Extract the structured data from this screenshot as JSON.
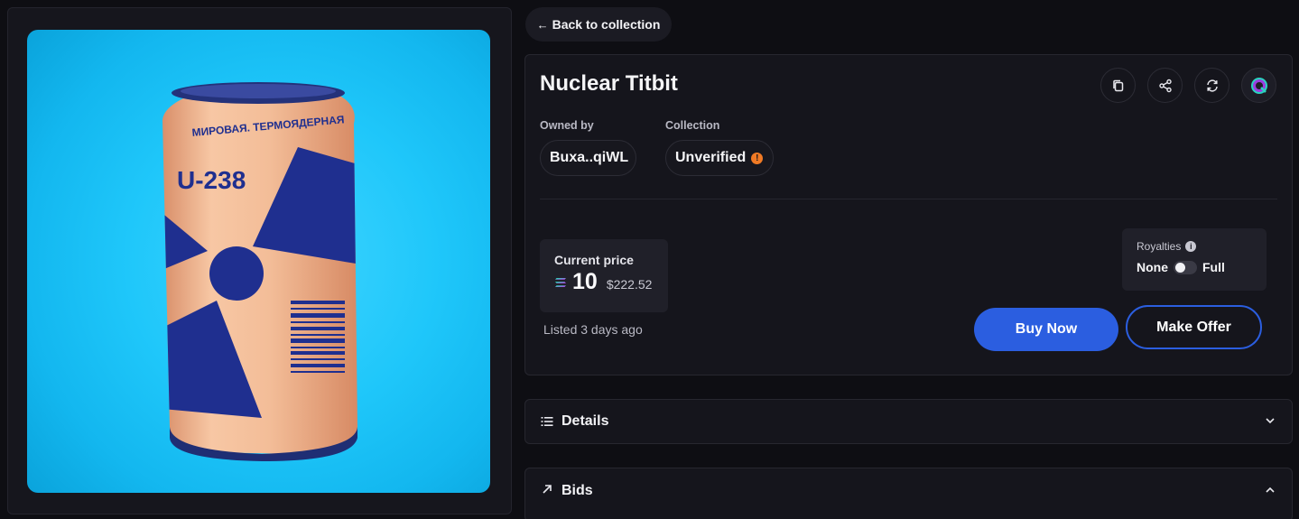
{
  "nav": {
    "back_label": "Back to collection"
  },
  "nft": {
    "title": "Nuclear Titbit",
    "image": {
      "alt": "Radioactive soda can",
      "can_text_top": "МИРОВАЯ. ТЕРМОЯДЕРНАЯ",
      "can_text_label": "U-238"
    }
  },
  "ownership": {
    "owned_by_label": "Owned by",
    "owner": "Buxa..qiWL",
    "collection_label": "Collection",
    "collection_value": "Unverified"
  },
  "actions_icons": [
    "copy-icon",
    "share-icon",
    "refresh-icon",
    "explorer-brand-icon"
  ],
  "price": {
    "label": "Current price",
    "value": "10",
    "currency_icon": "solana-icon",
    "usd": "$222.52",
    "listed": "Listed 3 days ago"
  },
  "royalties": {
    "label": "Royalties",
    "option_off": "None",
    "option_on": "Full",
    "enabled": false
  },
  "buttons": {
    "buy": "Buy Now",
    "offer": "Make Offer"
  },
  "sections": {
    "details": "Details",
    "bids": "Bids"
  },
  "colors": {
    "accent": "#2b5ee0",
    "warning": "#f07a25",
    "background": "#0e0e13",
    "image_bg": "#1fc7fa"
  }
}
